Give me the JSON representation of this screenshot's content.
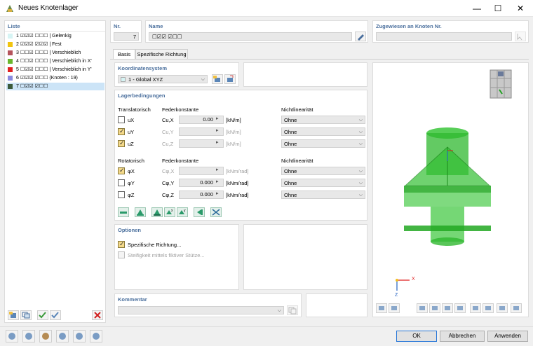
{
  "window": {
    "title": "Neues Knotenlager",
    "min": "—",
    "max": "☐",
    "close": "✕"
  },
  "list": {
    "header": "Liste",
    "items": [
      {
        "text": "1 ☑☑☑ ☐☐☐ | Gelenkig",
        "color": "#d6f4f4"
      },
      {
        "text": "2 ☑☑☑ ☑☑☑ | Fest",
        "color": "#f1c40f"
      },
      {
        "text": "3 ☐☐☑ ☐☐☐ | Verschieblich",
        "color": "#b5545c"
      },
      {
        "text": "4 ☐☐☑ ☐☐☐ | Verschieblich in X'",
        "color": "#69b62c"
      },
      {
        "text": "5 ☐☑☑ ☐☐☐ | Verschieblich in Y'",
        "color": "#e02020"
      },
      {
        "text": "6 ☑☑☑ ☑☐☐ (Knoten : 19)",
        "color": "#8a8ae0"
      },
      {
        "text": "7 ☐☑☑ ☑☐☐",
        "color": "#3b5a3b"
      }
    ]
  },
  "nr": {
    "label": "Nr.",
    "value": "7"
  },
  "name": {
    "label": "Name",
    "value": "☐☑☑ ☑☐☐"
  },
  "assigned": {
    "label": "Zugewiesen an Knoten Nr.",
    "value": ""
  },
  "tabs": [
    "Basis",
    "Spezifische Richtung"
  ],
  "coord": {
    "header": "Koordinatensystem",
    "value": "1 - Global XYZ"
  },
  "bearing": {
    "header": "Lagerbedingungen",
    "translatorisch": "Translatorisch",
    "federkonstante": "Federkonstante",
    "nichtlinearitaet": "Nichtlinearität",
    "rotatorisch": "Rotatorisch",
    "trans": [
      {
        "name": "uX",
        "spring": "Cu,X",
        "value": "0.00",
        "unit": "[kN/m]",
        "nl": "Ohne"
      },
      {
        "name": "uY",
        "spring": "Cu,Y",
        "value": "",
        "unit": "[kN/m]",
        "nl": "Ohne"
      },
      {
        "name": "uZ",
        "spring": "Cu,Z",
        "value": "",
        "unit": "[kN/m]",
        "nl": "Ohne"
      }
    ],
    "rot": [
      {
        "name": "φX",
        "spring": "Cφ,X",
        "value": "",
        "unit": "[kNm/rad]",
        "nl": "Ohne"
      },
      {
        "name": "φY",
        "spring": "Cφ,Y",
        "value": "0.000",
        "unit": "[kNm/rad]",
        "nl": "Ohne"
      },
      {
        "name": "φZ",
        "spring": "Cφ,Z",
        "value": "0.000",
        "unit": "[kNm/rad]",
        "nl": "Ohne"
      }
    ]
  },
  "options": {
    "header": "Optionen",
    "spez": "Spezifische Richtung...",
    "steif": "Steifigkeit mittels fiktiver Stütze..."
  },
  "comment": {
    "header": "Kommentar",
    "value": ""
  },
  "axes": {
    "x": "X",
    "z": "Z"
  },
  "buttons": {
    "ok": "OK",
    "cancel": "Abbrechen",
    "apply": "Anwenden"
  },
  "bottom_icons": [
    "search-icon",
    "number-icon",
    "color-icon",
    "node-icon",
    "help-icon",
    "formula-icon"
  ],
  "colors": {
    "accent": "#4a6f9d",
    "support_green": "#22c022"
  }
}
